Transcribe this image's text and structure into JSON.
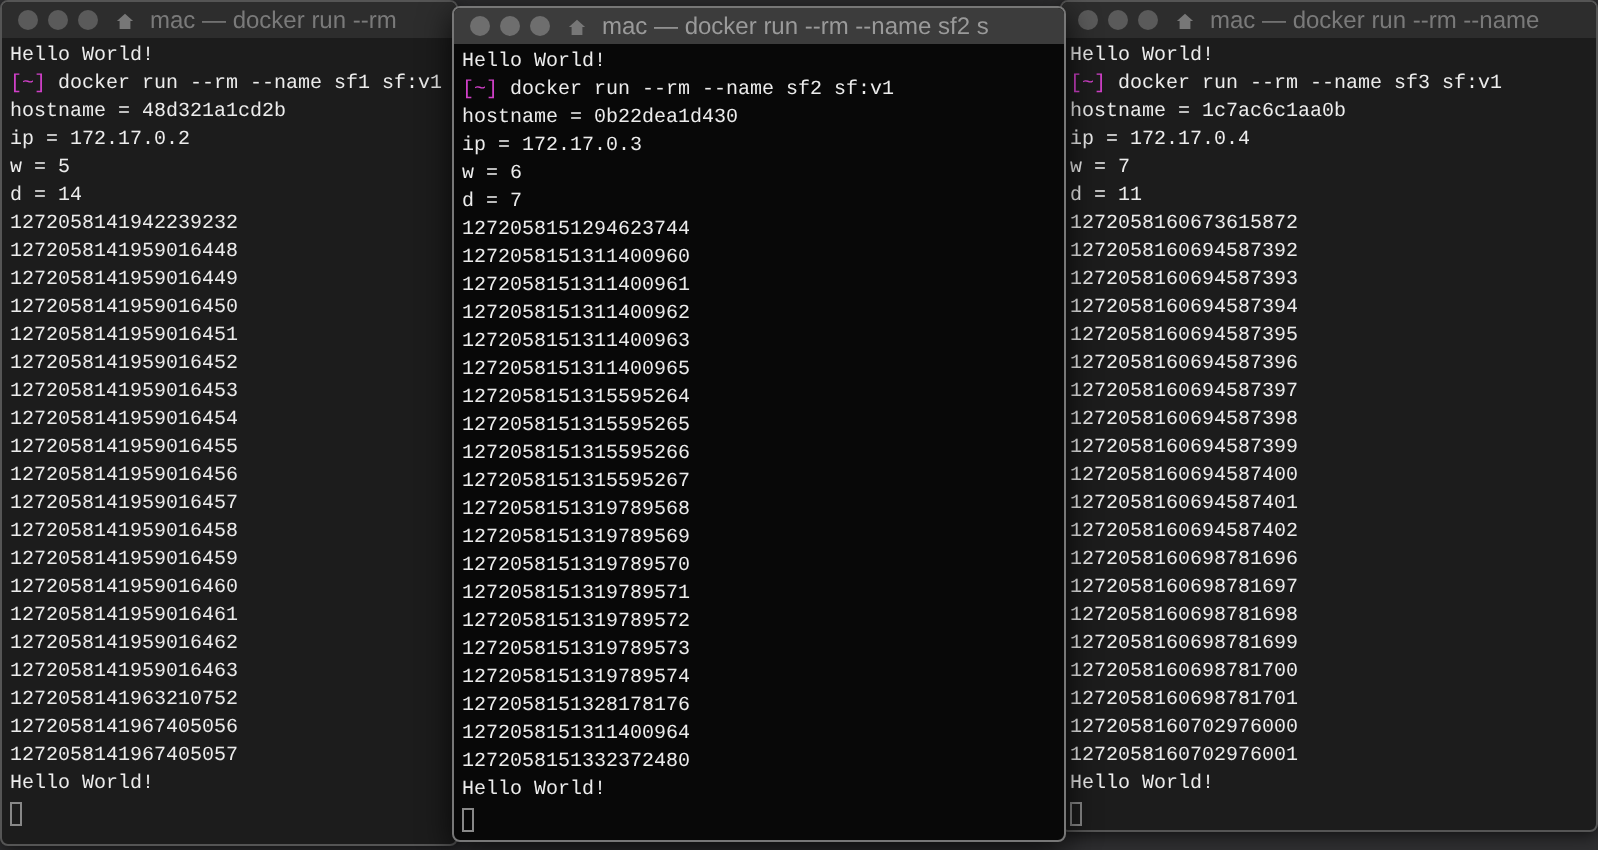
{
  "windows": [
    {
      "title": "mac — docker run --rm",
      "focused": false,
      "lines": [
        {
          "kind": "text",
          "text": "Hello World!"
        },
        {
          "kind": "prompt",
          "prompt": "[~]",
          "text": "docker run --rm --name sf1 sf:v1"
        },
        {
          "kind": "text",
          "text": "hostname = 48d321a1cd2b"
        },
        {
          "kind": "text",
          "text": "ip = 172.17.0.2"
        },
        {
          "kind": "text",
          "text": "w = 5"
        },
        {
          "kind": "text",
          "text": "d = 14"
        },
        {
          "kind": "text",
          "text": "1272058141942239232"
        },
        {
          "kind": "text",
          "text": "1272058141959016448"
        },
        {
          "kind": "text",
          "text": "1272058141959016449"
        },
        {
          "kind": "text",
          "text": "1272058141959016450"
        },
        {
          "kind": "text",
          "text": "1272058141959016451"
        },
        {
          "kind": "text",
          "text": "1272058141959016452"
        },
        {
          "kind": "text",
          "text": "1272058141959016453"
        },
        {
          "kind": "text",
          "text": "1272058141959016454"
        },
        {
          "kind": "text",
          "text": "1272058141959016455"
        },
        {
          "kind": "text",
          "text": "1272058141959016456"
        },
        {
          "kind": "text",
          "text": "1272058141959016457"
        },
        {
          "kind": "text",
          "text": "1272058141959016458"
        },
        {
          "kind": "text",
          "text": "1272058141959016459"
        },
        {
          "kind": "text",
          "text": "1272058141959016460"
        },
        {
          "kind": "text",
          "text": "1272058141959016461"
        },
        {
          "kind": "text",
          "text": "1272058141959016462"
        },
        {
          "kind": "text",
          "text": "1272058141959016463"
        },
        {
          "kind": "text",
          "text": "1272058141963210752"
        },
        {
          "kind": "text",
          "text": "1272058141967405056"
        },
        {
          "kind": "text",
          "text": "1272058141967405057"
        },
        {
          "kind": "text",
          "text": "Hello World!"
        },
        {
          "kind": "cursor"
        }
      ]
    },
    {
      "title": "mac — docker run --rm --name sf2 s",
      "focused": true,
      "lines": [
        {
          "kind": "text",
          "text": "Hello World!"
        },
        {
          "kind": "prompt",
          "prompt": "[~]",
          "text": "docker run --rm --name sf2 sf:v1"
        },
        {
          "kind": "text",
          "text": "hostname = 0b22dea1d430"
        },
        {
          "kind": "text",
          "text": "ip = 172.17.0.3"
        },
        {
          "kind": "text",
          "text": "w = 6"
        },
        {
          "kind": "text",
          "text": "d = 7"
        },
        {
          "kind": "text",
          "text": "1272058151294623744"
        },
        {
          "kind": "text",
          "text": "1272058151311400960"
        },
        {
          "kind": "text",
          "text": "1272058151311400961"
        },
        {
          "kind": "text",
          "text": "1272058151311400962"
        },
        {
          "kind": "text",
          "text": "1272058151311400963"
        },
        {
          "kind": "text",
          "text": "1272058151311400965"
        },
        {
          "kind": "text",
          "text": "1272058151315595264"
        },
        {
          "kind": "text",
          "text": "1272058151315595265"
        },
        {
          "kind": "text",
          "text": "1272058151315595266"
        },
        {
          "kind": "text",
          "text": "1272058151315595267"
        },
        {
          "kind": "text",
          "text": "1272058151319789568"
        },
        {
          "kind": "text",
          "text": "1272058151319789569"
        },
        {
          "kind": "text",
          "text": "1272058151319789570"
        },
        {
          "kind": "text",
          "text": "1272058151319789571"
        },
        {
          "kind": "text",
          "text": "1272058151319789572"
        },
        {
          "kind": "text",
          "text": "1272058151319789573"
        },
        {
          "kind": "text",
          "text": "1272058151319789574"
        },
        {
          "kind": "text",
          "text": "1272058151328178176"
        },
        {
          "kind": "text",
          "text": "1272058151311400964"
        },
        {
          "kind": "text",
          "text": "1272058151332372480"
        },
        {
          "kind": "text",
          "text": "Hello World!"
        },
        {
          "kind": "cursor"
        }
      ]
    },
    {
      "title": "mac — docker run --rm --name",
      "focused": false,
      "lines": [
        {
          "kind": "text",
          "text": "Hello World!"
        },
        {
          "kind": "prompt",
          "prompt": "[~]",
          "text": "docker run --rm --name sf3 sf:v1"
        },
        {
          "kind": "text",
          "text": "hostname = 1c7ac6c1aa0b"
        },
        {
          "kind": "text",
          "text": "ip = 172.17.0.4"
        },
        {
          "kind": "text",
          "text": "w = 7"
        },
        {
          "kind": "text",
          "text": "d = 11"
        },
        {
          "kind": "text",
          "text": "1272058160673615872"
        },
        {
          "kind": "text",
          "text": "1272058160694587392"
        },
        {
          "kind": "text",
          "text": "1272058160694587393"
        },
        {
          "kind": "text",
          "text": "1272058160694587394"
        },
        {
          "kind": "text",
          "text": "1272058160694587395"
        },
        {
          "kind": "text",
          "text": "1272058160694587396"
        },
        {
          "kind": "text",
          "text": "1272058160694587397"
        },
        {
          "kind": "text",
          "text": "1272058160694587398"
        },
        {
          "kind": "text",
          "text": "1272058160694587399"
        },
        {
          "kind": "text",
          "text": "1272058160694587400"
        },
        {
          "kind": "text",
          "text": "1272058160694587401"
        },
        {
          "kind": "text",
          "text": "1272058160694587402"
        },
        {
          "kind": "text",
          "text": "1272058160698781696"
        },
        {
          "kind": "text",
          "text": "1272058160698781697"
        },
        {
          "kind": "text",
          "text": "1272058160698781698"
        },
        {
          "kind": "text",
          "text": "1272058160698781699"
        },
        {
          "kind": "text",
          "text": "1272058160698781700"
        },
        {
          "kind": "text",
          "text": "1272058160698781701"
        },
        {
          "kind": "text",
          "text": "1272058160702976000"
        },
        {
          "kind": "text",
          "text": "1272058160702976001"
        },
        {
          "kind": "text",
          "text": "Hello World!"
        },
        {
          "kind": "cursor"
        }
      ]
    }
  ]
}
